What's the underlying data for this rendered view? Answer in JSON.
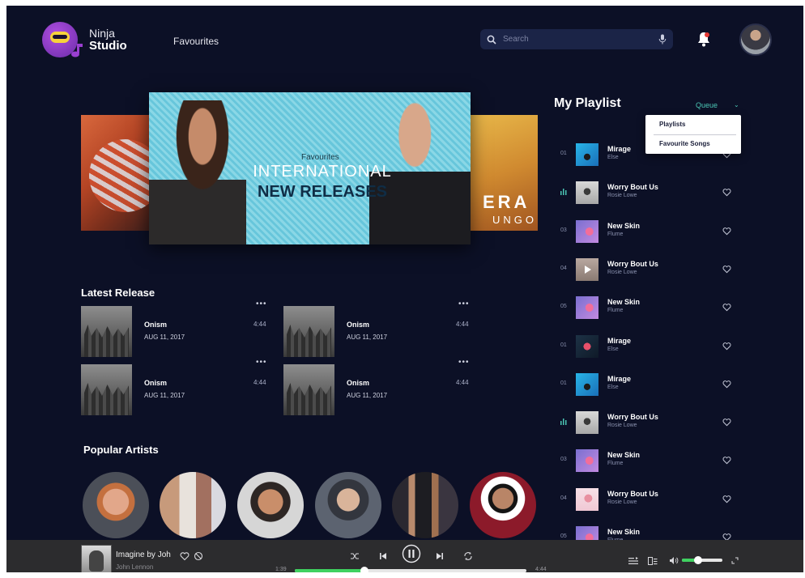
{
  "brand": {
    "line1": "Ninja",
    "line2": "Studio"
  },
  "nav": {
    "favourites": "Favourites"
  },
  "search": {
    "placeholder": "Search"
  },
  "hero": {
    "small": "Favourites",
    "title1": "INTERNATIONAL",
    "title2": "NEW RELEASES"
  },
  "side_right": {
    "big": "ERA",
    "small": "UNGO"
  },
  "latest": {
    "title": "Latest Release",
    "items": [
      {
        "name": "Onism",
        "date": "AUG 11, 2017",
        "duration": "4:44"
      },
      {
        "name": "Onism",
        "date": "AUG 11, 2017",
        "duration": "4:44"
      },
      {
        "name": "Onism",
        "date": "AUG 11, 2017",
        "duration": "4:44"
      },
      {
        "name": "Onism",
        "date": "AUG 11, 2017",
        "duration": "4:44"
      }
    ],
    "more": "•••"
  },
  "artists": {
    "title": "Popular Artists"
  },
  "playlist": {
    "title": "My Playlist",
    "queue": "Queue",
    "dropdown": [
      "Playlists",
      "Favourite Songs"
    ],
    "rows": [
      {
        "num": "01",
        "name": "Mirage",
        "artist": "Else",
        "thumb": "mirage"
      },
      {
        "num": "",
        "name": "Worry Bout Us",
        "artist": "Rosie Lowe",
        "thumb": "worry",
        "playing": true
      },
      {
        "num": "03",
        "name": "New Skin",
        "artist": "Flume",
        "thumb": "skin"
      },
      {
        "num": "04",
        "name": "Worry Bout Us",
        "artist": "Rosie Lowe",
        "thumb": "worry-play"
      },
      {
        "num": "05",
        "name": "New Skin",
        "artist": "Flume",
        "thumb": "skin"
      },
      {
        "num": "01",
        "name": "Mirage",
        "artist": "Else",
        "thumb": "mirage-dark"
      },
      {
        "num": "01",
        "name": "Mirage",
        "artist": "Else",
        "thumb": "mirage"
      },
      {
        "num": "",
        "name": "Worry Bout Us",
        "artist": "Rosie Lowe",
        "thumb": "worry",
        "playing": true
      },
      {
        "num": "03",
        "name": "New Skin",
        "artist": "Flume",
        "thumb": "skin"
      },
      {
        "num": "04",
        "name": "Worry Bout Us",
        "artist": "Rosie Lowe",
        "thumb": "worry-pink"
      },
      {
        "num": "05",
        "name": "New Skin",
        "artist": "Flume",
        "thumb": "skin"
      }
    ]
  },
  "player": {
    "title": "Imagine by Joh",
    "artist": "John Lennon",
    "elapsed": "1:39",
    "total": "4:44",
    "progress": 0.3,
    "volume": 0.4
  },
  "colors": {
    "bg": "#0c1026",
    "accent": "#3fd160",
    "queue": "#4bc6b5",
    "player_bg": "#2c2c2e"
  }
}
